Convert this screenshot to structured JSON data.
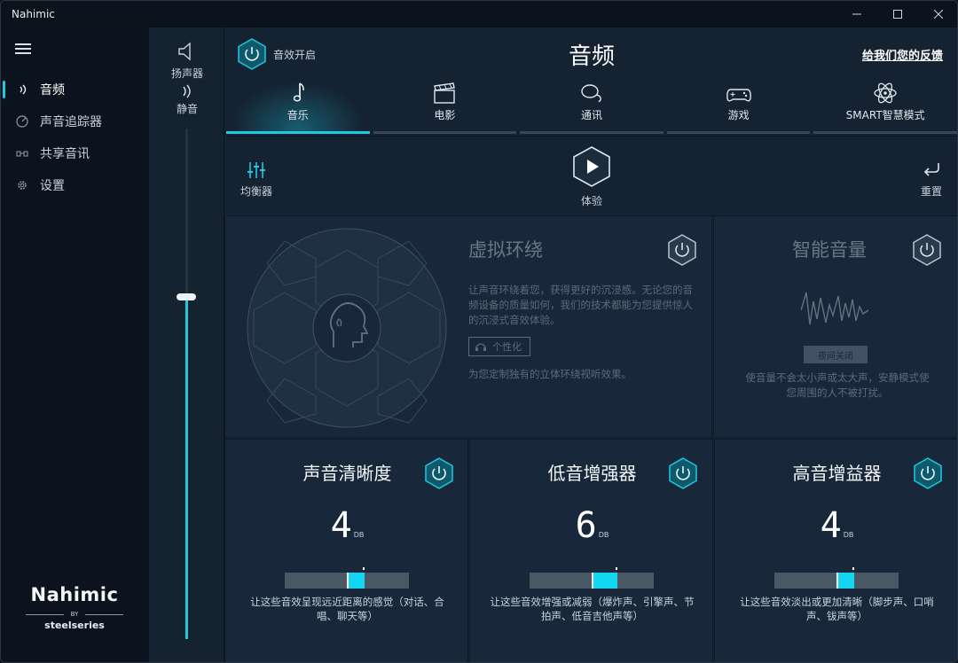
{
  "window": {
    "title": "Nahimic",
    "minimize": "—",
    "maximize": "☐",
    "close": "✕"
  },
  "sidebar": {
    "items": [
      {
        "label": "音频",
        "icon": "sound-wave-icon",
        "active": true
      },
      {
        "label": "声音追踪器",
        "icon": "radar-icon",
        "active": false
      },
      {
        "label": "共享音讯",
        "icon": "share-audio-icon",
        "active": false
      },
      {
        "label": "设置",
        "icon": "gear-icon",
        "active": false
      }
    ],
    "brand": {
      "logo": "Nahimic",
      "by": "BY",
      "maker": "steelseries"
    }
  },
  "volume": {
    "speaker_label": "扬声器",
    "mute_label": "静音",
    "level": 0.67
  },
  "header": {
    "power_label": "音效开启",
    "title": "音频",
    "feedback": "给我们您的反馈"
  },
  "tabs": [
    {
      "label": "音乐",
      "icon": "music-note-icon",
      "active": true
    },
    {
      "label": "电影",
      "icon": "clapperboard-icon",
      "active": false
    },
    {
      "label": "通讯",
      "icon": "chat-bubbles-icon",
      "active": false
    },
    {
      "label": "游戏",
      "icon": "gamepad-icon",
      "active": false
    },
    {
      "label": "SMART智慧模式",
      "icon": "atom-icon",
      "active": false
    }
  ],
  "toolbar": {
    "equalizer_label": "均衡器",
    "play_label": "体验",
    "reset_label": "重置"
  },
  "surround": {
    "title": "虚拟环绕",
    "desc": "让声音环绕着您，获得更好的沉浸感。无论您的音频设备的质量如何，我们的技术都能为您提供惊人的沉浸式音效体验。",
    "personalize": "个性化",
    "note": "为您定制独有的立体环绕视听效果。"
  },
  "smart_volume": {
    "title": "智能音量",
    "mode": "夜间关闭",
    "desc": "使音量不会太小声或太大声，安静模式使您周围的人不被打扰。"
  },
  "cards": [
    {
      "title": "声音清晰度",
      "value": "4",
      "unit": "DB",
      "level": 0.14,
      "desc": "让这些音效呈现远近距离的感觉（对话、合唱、聊天等）"
    },
    {
      "title": "低音增强器",
      "value": "6",
      "unit": "DB",
      "level": 0.21,
      "desc": "让这些音效增强或减弱（爆炸声、引擎声、节拍声、低音吉他声等）"
    },
    {
      "title": "高音增益器",
      "value": "4",
      "unit": "DB",
      "level": 0.14,
      "desc": "让这些音效淡出或更加清晰（脚步声、口哨声、钹声等）"
    }
  ],
  "colors": {
    "accent": "#20c8e0",
    "background": "#142231",
    "sidebar": "#0b141e"
  }
}
